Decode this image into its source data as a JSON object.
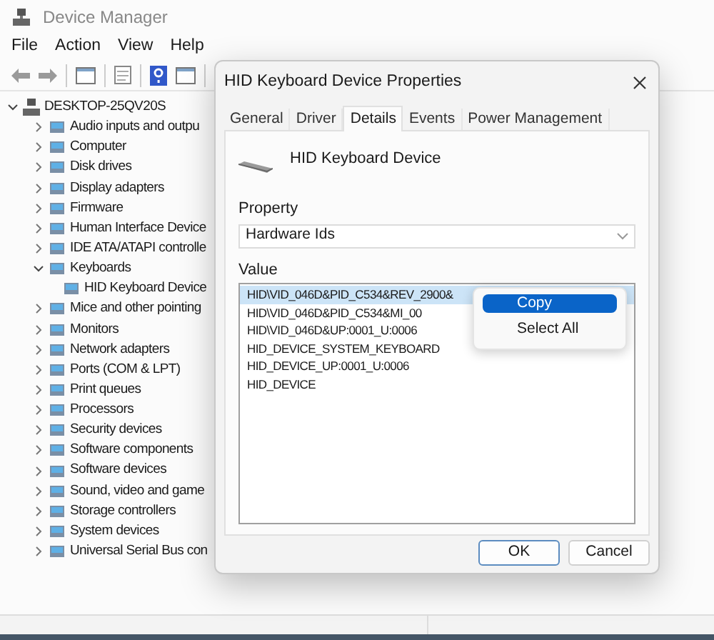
{
  "window": {
    "title": "Device Manager"
  },
  "menu": [
    "File",
    "Action",
    "View",
    "Help"
  ],
  "tree": [
    {
      "label": "DESKTOP-25QV20S",
      "expanded": true,
      "children": [
        {
          "label": "Audio inputs and outpu",
          "expanded": false
        },
        {
          "label": "Computer",
          "expanded": false
        },
        {
          "label": "Disk drives",
          "expanded": false
        },
        {
          "label": "Display adapters",
          "expanded": false
        },
        {
          "label": "Firmware",
          "expanded": false
        },
        {
          "label": "Human Interface Device",
          "expanded": false
        },
        {
          "label": "IDE ATA/ATAPI controlle",
          "expanded": false
        },
        {
          "label": "Keyboards",
          "expanded": true,
          "children": [
            {
              "label": "HID Keyboard Device"
            }
          ]
        },
        {
          "label": "Mice and other pointing",
          "expanded": false
        },
        {
          "label": "Monitors",
          "expanded": false
        },
        {
          "label": "Network adapters",
          "expanded": false
        },
        {
          "label": "Ports (COM & LPT)",
          "expanded": false
        },
        {
          "label": "Print queues",
          "expanded": false
        },
        {
          "label": "Processors",
          "expanded": false
        },
        {
          "label": "Security devices",
          "expanded": false
        },
        {
          "label": "Software components",
          "expanded": false
        },
        {
          "label": "Software devices",
          "expanded": false
        },
        {
          "label": "Sound, video and game",
          "expanded": false
        },
        {
          "label": "Storage controllers",
          "expanded": false
        },
        {
          "label": "System devices",
          "expanded": false
        },
        {
          "label": "Universal Serial Bus con",
          "expanded": false
        }
      ]
    }
  ],
  "dialog": {
    "title": "HID Keyboard Device Properties",
    "tabs": [
      {
        "label": "General",
        "selected": false
      },
      {
        "label": "Driver",
        "selected": false
      },
      {
        "label": "Details",
        "selected": true
      },
      {
        "label": "Events",
        "selected": false
      },
      {
        "label": "Power Management",
        "selected": false
      }
    ],
    "device_name": "HID Keyboard Device",
    "property_label": "Property",
    "property_value": "Hardware Ids",
    "value_label": "Value",
    "values": [
      {
        "text": "HID\\VID_046D&PID_C534&REV_2900&",
        "selected": true
      },
      {
        "text": "HID\\VID_046D&PID_C534&MI_00",
        "selected": false
      },
      {
        "text": "HID\\VID_046D&UP:0001_U:0006",
        "selected": false
      },
      {
        "text": "HID_DEVICE_SYSTEM_KEYBOARD",
        "selected": false
      },
      {
        "text": "HID_DEVICE_UP:0001_U:0006",
        "selected": false
      },
      {
        "text": "HID_DEVICE",
        "selected": false
      }
    ],
    "context_menu": [
      {
        "label": "Copy",
        "selected": true
      },
      {
        "label": "Select All",
        "selected": false
      }
    ],
    "buttons": [
      "OK",
      "Cancel"
    ]
  }
}
